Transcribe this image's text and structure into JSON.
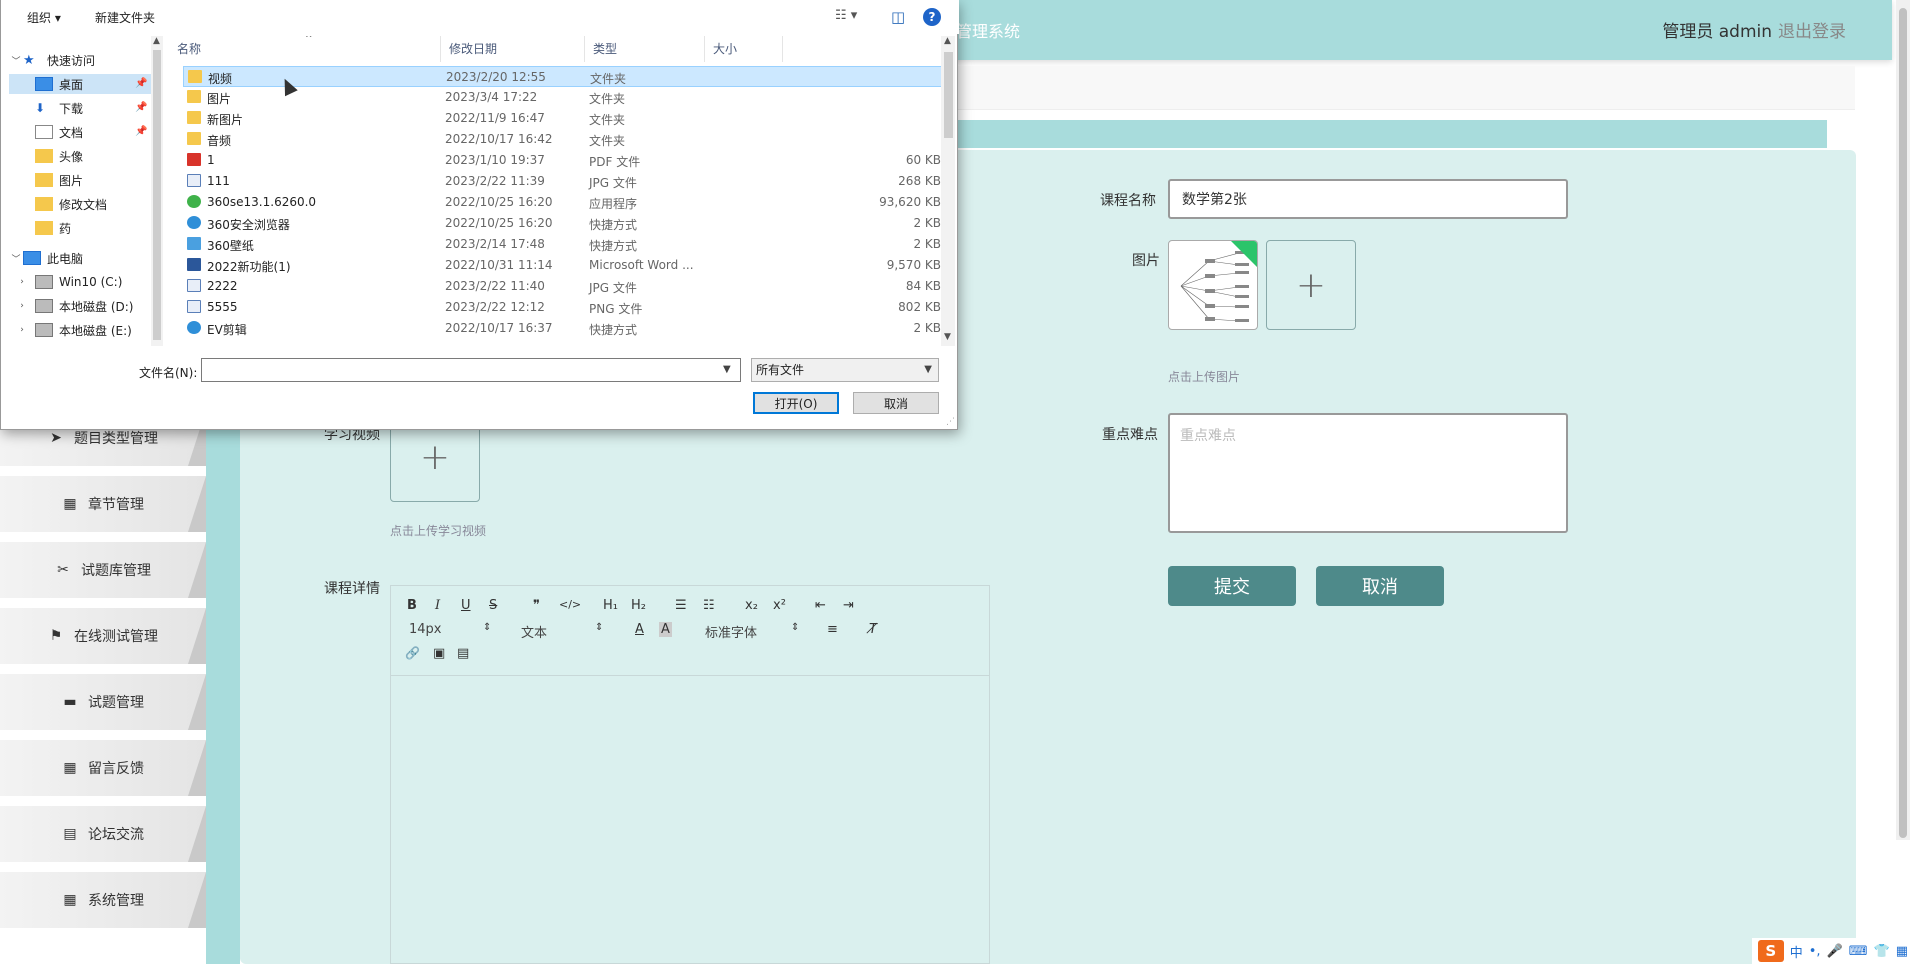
{
  "app": {
    "title_fragment": "库管理系统",
    "user": "管理员 admin",
    "logout": "退出登录"
  },
  "sidebar": {
    "items": [
      {
        "label": "题目类型管理",
        "icon": "paper-plane-icon",
        "glyph": "➤"
      },
      {
        "label": "章节管理",
        "icon": "grid-icon",
        "glyph": "▦"
      },
      {
        "label": "试题库管理",
        "icon": "tools-icon",
        "glyph": "✂"
      },
      {
        "label": "在线测试管理",
        "icon": "flag-icon",
        "glyph": "⚑"
      },
      {
        "label": "试题管理",
        "icon": "monitor-icon",
        "glyph": "▬"
      },
      {
        "label": "留言反馈",
        "icon": "grid-icon",
        "glyph": "▦"
      },
      {
        "label": "论坛交流",
        "icon": "clipboard-icon",
        "glyph": "▤"
      },
      {
        "label": "系统管理",
        "icon": "grid-icon",
        "glyph": "▦"
      }
    ]
  },
  "form": {
    "course_name_label": "课程名称",
    "course_name_value": "数学第2张",
    "image_label": "图片",
    "image_hint": "点击上传图片",
    "video_label": "学习视频",
    "video_hint": "点击上传学习视频",
    "key_points_label": "重点难点",
    "key_points_placeholder": "重点难点",
    "detail_label": "课程详情",
    "submit": "提交",
    "cancel": "取消",
    "plus": "+"
  },
  "editor": {
    "font_size": "14px",
    "text_type": "文本",
    "font_family": "标准字体",
    "buttons": {
      "bold": "B",
      "italic": "I",
      "underline": "U",
      "strike": "S",
      "quote": "❞",
      "code": "</>",
      "h1": "H₁",
      "h2": "H₂",
      "ol": "☰",
      "ul": "☷",
      "sub": "x₂",
      "sup": "x²",
      "outdent": "⇤",
      "indent": "⇥",
      "color": "A",
      "bg": "A",
      "align": "≡",
      "clear": "T̸",
      "link": "🔗",
      "image": "▣",
      "video": "▤"
    }
  },
  "ime": {
    "logo": "S",
    "lang": "中",
    "punct": "•,",
    "mic": "🎤",
    "kbd": "⌨",
    "shirt": "👕",
    "grid": "▦"
  },
  "dialog": {
    "organize": "组织 ▾",
    "new_folder": "新建文件夹",
    "view_icon": "☷ ▾",
    "pane_icon": "◫",
    "help": "?",
    "nav": [
      {
        "label": "快速访问",
        "type": "star",
        "level": 0
      },
      {
        "label": "桌面",
        "type": "desktop",
        "level": 1,
        "pinned": true,
        "selected": true
      },
      {
        "label": "下载",
        "type": "download",
        "level": 1,
        "pinned": true
      },
      {
        "label": "文档",
        "type": "doc",
        "level": 1,
        "pinned": true
      },
      {
        "label": "头像",
        "type": "folder",
        "level": 1
      },
      {
        "label": "图片",
        "type": "folder",
        "level": 1
      },
      {
        "label": "修改文档",
        "type": "folder",
        "level": 1
      },
      {
        "label": "药",
        "type": "folder",
        "level": 1
      },
      {
        "label": "此电脑",
        "type": "pc",
        "level": 0
      },
      {
        "label": "Win10 (C:)",
        "type": "drive",
        "level": 1
      },
      {
        "label": "本地磁盘 (D:)",
        "type": "drive",
        "level": 1
      },
      {
        "label": "本地磁盘 (E:)",
        "type": "drive",
        "level": 1
      }
    ],
    "columns": {
      "name": "名称",
      "date": "修改日期",
      "type": "类型",
      "size": "大小"
    },
    "files": [
      {
        "name": "视频",
        "date": "2023/2/20 12:55",
        "type": "文件夹",
        "size": "",
        "kind": "folder"
      },
      {
        "name": "图片",
        "date": "2023/3/4 17:22",
        "type": "文件夹",
        "size": "",
        "kind": "folder"
      },
      {
        "name": "新图片",
        "date": "2022/11/9 16:47",
        "type": "文件夹",
        "size": "",
        "kind": "folder"
      },
      {
        "name": "音频",
        "date": "2022/10/17 16:42",
        "type": "文件夹",
        "size": "",
        "kind": "folder"
      },
      {
        "name": "1",
        "date": "2023/1/10 19:37",
        "type": "PDF 文件",
        "size": "60 KB",
        "kind": "pdf"
      },
      {
        "name": "111",
        "date": "2023/2/22 11:39",
        "type": "JPG 文件",
        "size": "268 KB",
        "kind": "image"
      },
      {
        "name": "360se13.1.6260.0",
        "date": "2022/10/25 16:20",
        "type": "应用程序",
        "size": "93,620 KB",
        "kind": "app"
      },
      {
        "name": "360安全浏览器",
        "date": "2022/10/25 16:20",
        "type": "快捷方式",
        "size": "2 KB",
        "kind": "shortcut"
      },
      {
        "name": "360壁纸",
        "date": "2023/2/14 17:48",
        "type": "快捷方式",
        "size": "2 KB",
        "kind": "shortcut2"
      },
      {
        "name": "2022新功能(1)",
        "date": "2022/10/31 11:14",
        "type": "Microsoft Word ...",
        "size": "9,570 KB",
        "kind": "word"
      },
      {
        "name": "2222",
        "date": "2023/2/22 11:40",
        "type": "JPG 文件",
        "size": "84 KB",
        "kind": "image"
      },
      {
        "name": "5555",
        "date": "2023/2/22 12:12",
        "type": "PNG 文件",
        "size": "802 KB",
        "kind": "image"
      },
      {
        "name": "EV剪辑",
        "date": "2022/10/17 16:37",
        "type": "快捷方式",
        "size": "2 KB",
        "kind": "shortcut"
      }
    ],
    "file_name_label": "文件名(N):",
    "file_name_value": "",
    "file_type": "所有文件",
    "open": "打开(O)",
    "cancel": "取消"
  }
}
